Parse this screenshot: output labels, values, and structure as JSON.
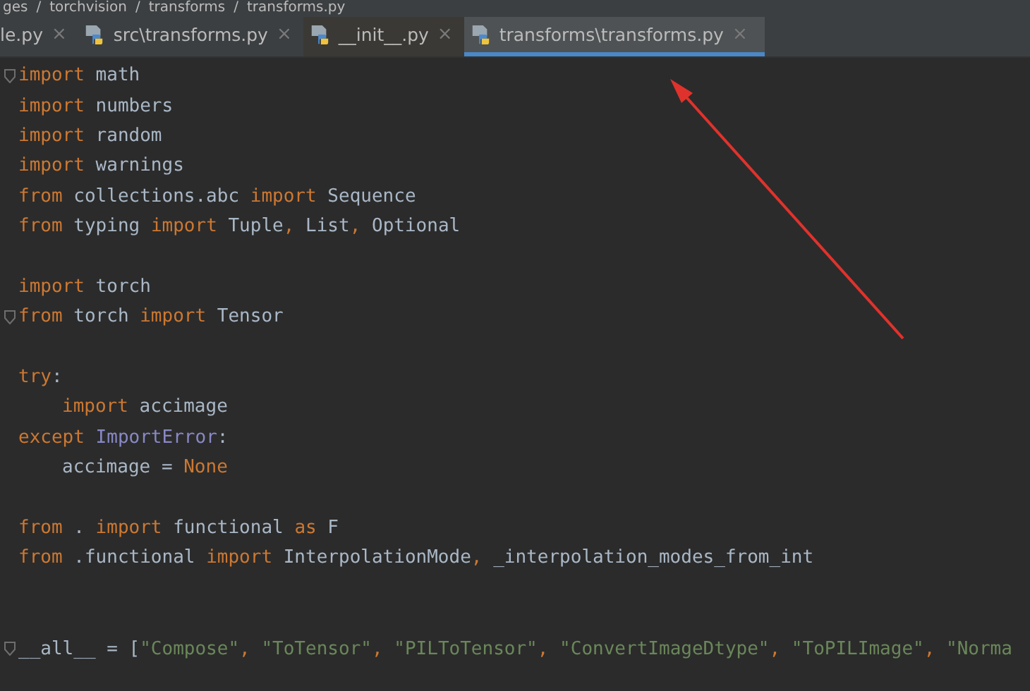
{
  "breadcrumb": {
    "separator": "/",
    "items": [
      "ges",
      "torchvision",
      "transforms",
      "transforms.py"
    ]
  },
  "tabs": [
    {
      "label": "le.py",
      "selected": false,
      "icon": false,
      "close": "×"
    },
    {
      "label": "src\\transforms.py",
      "selected": false,
      "icon": true,
      "close": "×"
    },
    {
      "label": "__init__.py",
      "selected": false,
      "icon": true,
      "close": "×"
    },
    {
      "label": "transforms\\transforms.py",
      "selected": true,
      "icon": true,
      "close": "×"
    }
  ],
  "code": [
    {
      "kind": "code",
      "fold": true,
      "indent": false,
      "tokens": [
        {
          "text": "import",
          "kind": "keyword"
        },
        {
          "text": " math",
          "kind": "name"
        }
      ]
    },
    {
      "kind": "code",
      "fold": false,
      "indent": false,
      "tokens": [
        {
          "text": "import",
          "kind": "keyword"
        },
        {
          "text": " numbers",
          "kind": "name"
        }
      ]
    },
    {
      "kind": "code",
      "fold": false,
      "indent": false,
      "tokens": [
        {
          "text": "import",
          "kind": "keyword"
        },
        {
          "text": " random",
          "kind": "name"
        }
      ]
    },
    {
      "kind": "code",
      "fold": false,
      "indent": false,
      "tokens": [
        {
          "text": "import",
          "kind": "keyword"
        },
        {
          "text": " warnings",
          "kind": "name"
        }
      ]
    },
    {
      "kind": "code",
      "fold": false,
      "indent": false,
      "tokens": [
        {
          "text": "from",
          "kind": "keyword"
        },
        {
          "text": " collections.abc ",
          "kind": "name"
        },
        {
          "text": "import",
          "kind": "keyword"
        },
        {
          "text": " Sequence",
          "kind": "name"
        }
      ]
    },
    {
      "kind": "code",
      "fold": false,
      "indent": false,
      "tokens": [
        {
          "text": "from",
          "kind": "keyword"
        },
        {
          "text": " typing ",
          "kind": "name"
        },
        {
          "text": "import",
          "kind": "keyword"
        },
        {
          "text": " Tuple",
          "kind": "name"
        },
        {
          "text": ", ",
          "kind": "keyword"
        },
        {
          "text": "List",
          "kind": "name"
        },
        {
          "text": ", ",
          "kind": "keyword"
        },
        {
          "text": "Optional",
          "kind": "name"
        }
      ]
    },
    {
      "kind": "blank"
    },
    {
      "kind": "code",
      "fold": false,
      "indent": false,
      "tokens": [
        {
          "text": "import",
          "kind": "keyword"
        },
        {
          "text": " torch",
          "kind": "name"
        }
      ]
    },
    {
      "kind": "code",
      "fold": true,
      "indent": false,
      "tokens": [
        {
          "text": "from",
          "kind": "keyword"
        },
        {
          "text": " torch ",
          "kind": "name"
        },
        {
          "text": "import",
          "kind": "keyword"
        },
        {
          "text": " Tensor",
          "kind": "name"
        }
      ]
    },
    {
      "kind": "blank"
    },
    {
      "kind": "code",
      "fold": false,
      "indent": false,
      "tokens": [
        {
          "text": "try",
          "kind": "keyword"
        },
        {
          "text": ":",
          "kind": "name"
        }
      ]
    },
    {
      "kind": "code",
      "fold": false,
      "indent": true,
      "tokens": [
        {
          "text": "import",
          "kind": "keyword"
        },
        {
          "text": " accimage",
          "kind": "name"
        }
      ]
    },
    {
      "kind": "code",
      "fold": false,
      "indent": false,
      "tokens": [
        {
          "text": "except ",
          "kind": "keyword"
        },
        {
          "text": "ImportError",
          "kind": "class"
        },
        {
          "text": ":",
          "kind": "name"
        }
      ]
    },
    {
      "kind": "code",
      "fold": false,
      "indent": true,
      "tokens": [
        {
          "text": "accimage = ",
          "kind": "name"
        },
        {
          "text": "None",
          "kind": "keyword"
        }
      ]
    },
    {
      "kind": "blank"
    },
    {
      "kind": "code",
      "fold": false,
      "indent": false,
      "tokens": [
        {
          "text": "from",
          "kind": "keyword"
        },
        {
          "text": " . ",
          "kind": "name"
        },
        {
          "text": "import",
          "kind": "keyword"
        },
        {
          "text": " functional ",
          "kind": "name"
        },
        {
          "text": "as",
          "kind": "keyword"
        },
        {
          "text": " F",
          "kind": "name"
        }
      ]
    },
    {
      "kind": "code",
      "fold": false,
      "indent": false,
      "tokens": [
        {
          "text": "from",
          "kind": "keyword"
        },
        {
          "text": " .functional ",
          "kind": "name"
        },
        {
          "text": "import",
          "kind": "keyword"
        },
        {
          "text": " InterpolationMode",
          "kind": "name"
        },
        {
          "text": ", ",
          "kind": "keyword"
        },
        {
          "text": "_interpolation_modes_from_int",
          "kind": "name"
        }
      ]
    },
    {
      "kind": "blank"
    },
    {
      "kind": "blank"
    },
    {
      "kind": "code",
      "fold": true,
      "indent": false,
      "tokens": [
        {
          "text": "__all__ = [",
          "kind": "name"
        },
        {
          "text": "\"Compose\"",
          "kind": "string"
        },
        {
          "text": ", ",
          "kind": "keyword"
        },
        {
          "text": "\"ToTensor\"",
          "kind": "string"
        },
        {
          "text": ", ",
          "kind": "keyword"
        },
        {
          "text": "\"PILToTensor\"",
          "kind": "string"
        },
        {
          "text": ", ",
          "kind": "keyword"
        },
        {
          "text": "\"ConvertImageDtype\"",
          "kind": "string"
        },
        {
          "text": ", ",
          "kind": "keyword"
        },
        {
          "text": "\"ToPILImage\"",
          "kind": "string"
        },
        {
          "text": ", ",
          "kind": "keyword"
        },
        {
          "text": "\"Norma",
          "kind": "string"
        }
      ]
    }
  ]
}
